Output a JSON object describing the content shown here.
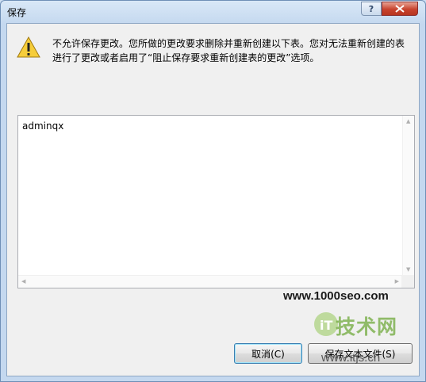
{
  "window": {
    "title": "保存",
    "help_label": "?",
    "close_label": "✕"
  },
  "message": {
    "icon": "warning-icon",
    "text": "不允许保存更改。您所做的更改要求删除并重新创建以下表。您对无法重新创建的表进行了更改或者启用了“阻止保存要求重新创建表的更改”选项。"
  },
  "list": {
    "items": [
      "adminqx"
    ]
  },
  "watermark": {
    "url": "www.1000seo.com",
    "logo_text": "技术网",
    "logo_sub": "www.itjs.cn"
  },
  "buttons": {
    "cancel_label": "取消(C)",
    "save_text_label": "保存文本文件(S)"
  }
}
